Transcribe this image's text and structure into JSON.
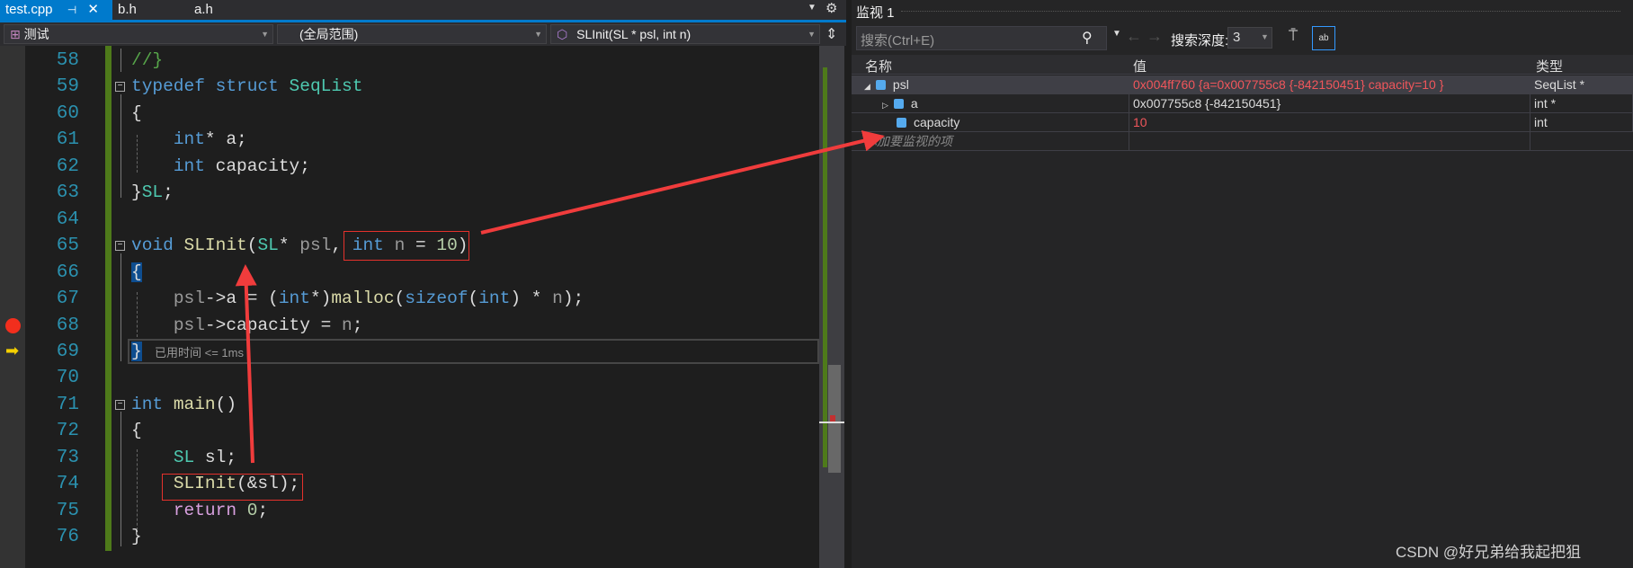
{
  "editor": {
    "tabs": [
      {
        "label": "test.cpp",
        "active": true
      },
      {
        "label": "b.h"
      },
      {
        "label": "a.h"
      }
    ],
    "pin_icon": "pin-icon",
    "close_icon": "close-icon",
    "nav": {
      "project": "测试",
      "scope": "(全局范围)",
      "function": "SLInit(SL * psl, int n)"
    },
    "timing_tip": "已用时间 <= 1ms",
    "lines": [
      {
        "n": "58",
        "tokens": [
          [
            "//}",
            "cm"
          ]
        ]
      },
      {
        "n": "59",
        "tokens": [
          [
            "typedef",
            "kw"
          ],
          [
            " ",
            "pl"
          ],
          [
            "struct",
            "kw"
          ],
          [
            " ",
            "pl"
          ],
          [
            "SeqList",
            "ty"
          ]
        ],
        "fold": true
      },
      {
        "n": "60",
        "tokens": [
          [
            "{",
            "pl"
          ]
        ]
      },
      {
        "n": "61",
        "tokens": [
          [
            "    ",
            "pl"
          ],
          [
            "int",
            "kw"
          ],
          [
            "* a;",
            "pl"
          ]
        ]
      },
      {
        "n": "62",
        "tokens": [
          [
            "    ",
            "pl"
          ],
          [
            "int",
            "kw"
          ],
          [
            " capacity;",
            "pl"
          ]
        ]
      },
      {
        "n": "63",
        "tokens": [
          [
            "}",
            "pl"
          ],
          [
            "SL",
            "ty"
          ],
          [
            ";",
            "pl"
          ]
        ]
      },
      {
        "n": "64",
        "tokens": []
      },
      {
        "n": "65",
        "tokens": [
          [
            "void",
            "kw"
          ],
          [
            " ",
            "pl"
          ],
          [
            "SLInit",
            "fn"
          ],
          [
            "(",
            "pl"
          ],
          [
            "SL",
            "ty"
          ],
          [
            "* ",
            "pl"
          ],
          [
            "psl",
            "pa"
          ],
          [
            ", ",
            "pl"
          ],
          [
            "int",
            "kw"
          ],
          [
            " ",
            "pl"
          ],
          [
            "n",
            "pa"
          ],
          [
            " = ",
            "pl"
          ],
          [
            "10",
            "nu"
          ],
          [
            ")",
            "pl"
          ]
        ],
        "fold": true
      },
      {
        "n": "66",
        "tokens": [
          [
            "{",
            "hl"
          ]
        ]
      },
      {
        "n": "67",
        "tokens": [
          [
            "    ",
            "pl"
          ],
          [
            "psl",
            "pa"
          ],
          [
            "->a = (",
            "pl"
          ],
          [
            "int",
            "kw"
          ],
          [
            "*)",
            "pl"
          ],
          [
            "malloc",
            "fn"
          ],
          [
            "(",
            "pl"
          ],
          [
            "sizeof",
            "kw"
          ],
          [
            "(",
            "pl"
          ],
          [
            "int",
            "kw"
          ],
          [
            ") * ",
            "pl"
          ],
          [
            "n",
            "pa"
          ],
          [
            ");",
            "pl"
          ]
        ]
      },
      {
        "n": "68",
        "tokens": [
          [
            "    ",
            "pl"
          ],
          [
            "psl",
            "pa"
          ],
          [
            "->capacity = ",
            "pl"
          ],
          [
            "n",
            "pa"
          ],
          [
            ";",
            "pl"
          ]
        ],
        "breakpoint": true
      },
      {
        "n": "69",
        "tokens": [
          [
            "}",
            "hl"
          ]
        ],
        "current": true
      },
      {
        "n": "70",
        "tokens": []
      },
      {
        "n": "71",
        "tokens": [
          [
            "int",
            "kw"
          ],
          [
            " ",
            "pl"
          ],
          [
            "main",
            "fn"
          ],
          [
            "()",
            "pl"
          ]
        ],
        "fold": true
      },
      {
        "n": "72",
        "tokens": [
          [
            "{",
            "pl"
          ]
        ]
      },
      {
        "n": "73",
        "tokens": [
          [
            "    ",
            "pl"
          ],
          [
            "SL",
            "ty"
          ],
          [
            " sl;",
            "pl"
          ]
        ]
      },
      {
        "n": "74",
        "tokens": [
          [
            "    ",
            "pl"
          ],
          [
            "SLInit",
            "fn"
          ],
          [
            "(&sl);",
            "pl"
          ]
        ]
      },
      {
        "n": "75",
        "tokens": [
          [
            "    ",
            "pl"
          ],
          [
            "return",
            "rt"
          ],
          [
            " ",
            "pl"
          ],
          [
            "0",
            "nu"
          ],
          [
            ";",
            "pl"
          ]
        ]
      },
      {
        "n": "76",
        "tokens": [
          [
            "}",
            "pl"
          ]
        ]
      }
    ]
  },
  "watch": {
    "title": "监视 1",
    "search_placeholder": "搜索(Ctrl+E)",
    "depth_label": "搜索深度:",
    "depth_value": "3",
    "columns": [
      "名称",
      "值",
      "类型"
    ],
    "rows": [
      {
        "name": "psl",
        "value": "0x004ff760 {a=0x007755c8 {-842150451} capacity=10 }",
        "type": "SeqList *",
        "expanded": true,
        "changed": true
      },
      {
        "name": "a",
        "value": "0x007755c8 {-842150451}",
        "type": "int *",
        "expandable": true
      },
      {
        "name": "capacity",
        "value": "10",
        "type": "int",
        "changed": true
      }
    ],
    "add_item": "添加要监视的项"
  },
  "watermark": "CSDN @好兄弟给我起把狙",
  "colors": {
    "accent": "#007acc",
    "annotation": "#e5312c",
    "changed_value": "#f0565b"
  }
}
